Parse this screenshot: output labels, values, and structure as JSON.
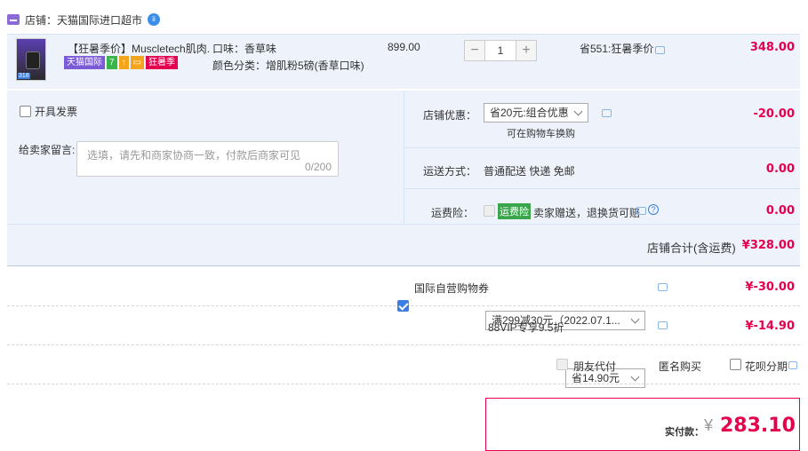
{
  "shop": {
    "prefix": "店铺：",
    "name": "天猫国际进口超市",
    "ww_badge": "ii"
  },
  "item": {
    "title": "【狂暑季价】Muscletech肌肉...",
    "tags": [
      {
        "text": "天猫国际",
        "color": "#7b5bd6"
      },
      {
        "text": "7",
        "color": "#39b54a"
      },
      {
        "text": "↑",
        "color": "#f4a51c"
      },
      {
        "text": "▭",
        "color": "#f4a51c"
      },
      {
        "text": "狂暑季",
        "color": "#e5004f"
      }
    ],
    "thumb_badge": "318",
    "attr1": "口味：香草味",
    "attr2": "颜色分类：增肌粉5磅(香草口味)",
    "price": "899.00",
    "qty": "1",
    "minus": "−",
    "plus": "+",
    "saving": "省551:狂暑季价",
    "subtotal": "348.00"
  },
  "invoice": {
    "label": "开具发票"
  },
  "message": {
    "label": "给卖家留言:",
    "placeholder": "选填，请先和商家协商一致，付款后商家可见",
    "count": "0/200"
  },
  "shop_coupon": {
    "label": "店铺优惠：",
    "selected": "省20元:组合优惠",
    "note": "可在购物车换购",
    "amount": "-20.00"
  },
  "delivery": {
    "label": "运送方式：",
    "value": "普通配送 快递 免邮",
    "amount": "0.00"
  },
  "insurance": {
    "label": "运费险：",
    "badge": "运费险",
    "text": "卖家赠送，退换货可赔",
    "amount": "0.00"
  },
  "shop_total": {
    "label": "店铺合计(含运费)",
    "amount": "¥328.00"
  },
  "global_coupon": {
    "label": "国际自营购物券",
    "selected": "满299减30元（2022.07.1...",
    "amount": "¥-30.00"
  },
  "vip": {
    "label": "88VIP专享9.5折",
    "selected": "省14.90元",
    "amount": "¥-14.90"
  },
  "options": {
    "friend_pay": "朋友代付",
    "anonymous": "匿名购买",
    "huabei": "花呗分期"
  },
  "pay": {
    "label": "实付款：",
    "currency": "¥",
    "amount": "283.10"
  }
}
